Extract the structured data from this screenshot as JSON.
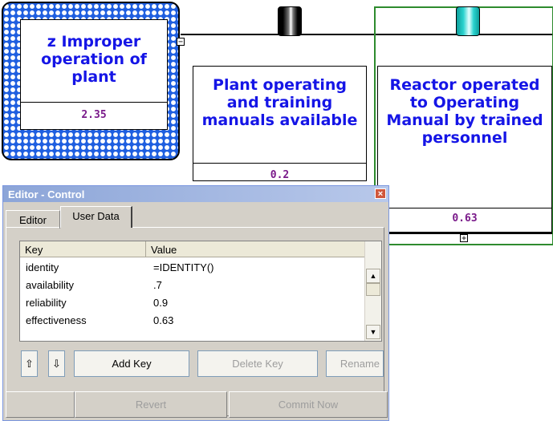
{
  "hazard": {
    "title": "z Improper operation of plant",
    "value": "2.35",
    "collapse_glyph": "−"
  },
  "barrier1": {
    "title": "Plant operating and training manuals available",
    "value": "0.2"
  },
  "barrier2": {
    "title": "Reactor operated to Operating Manual by trained personnel",
    "value": "0.63",
    "expand_glyph": "+"
  },
  "dialog": {
    "title": "Editor - Control",
    "close_glyph": "×",
    "tabs": [
      "Editor",
      "User Data"
    ],
    "columns": [
      "Key",
      "Value"
    ],
    "rows": [
      {
        "key": "identity",
        "value": "=IDENTITY()"
      },
      {
        "key": "availability",
        "value": ".7"
      },
      {
        "key": "reliability",
        "value": "0.9"
      },
      {
        "key": "effectiveness",
        "value": "0.63"
      }
    ],
    "buttons": {
      "move_up": "⇧",
      "move_down": "⇩",
      "add_key": "Add Key",
      "delete_key": "Delete Key",
      "rename": "Rename",
      "revert": "Revert",
      "commit_now": "Commit Now"
    },
    "scroll_up": "▲",
    "scroll_down": "▼"
  },
  "colors": {
    "node_title": "#1515e6",
    "node_value": "#7a1a8a",
    "hazard_fill": "#1f5fe0",
    "barrier2_border": "#2e8b2e",
    "barrier2_cap": "#2ad3cf"
  }
}
